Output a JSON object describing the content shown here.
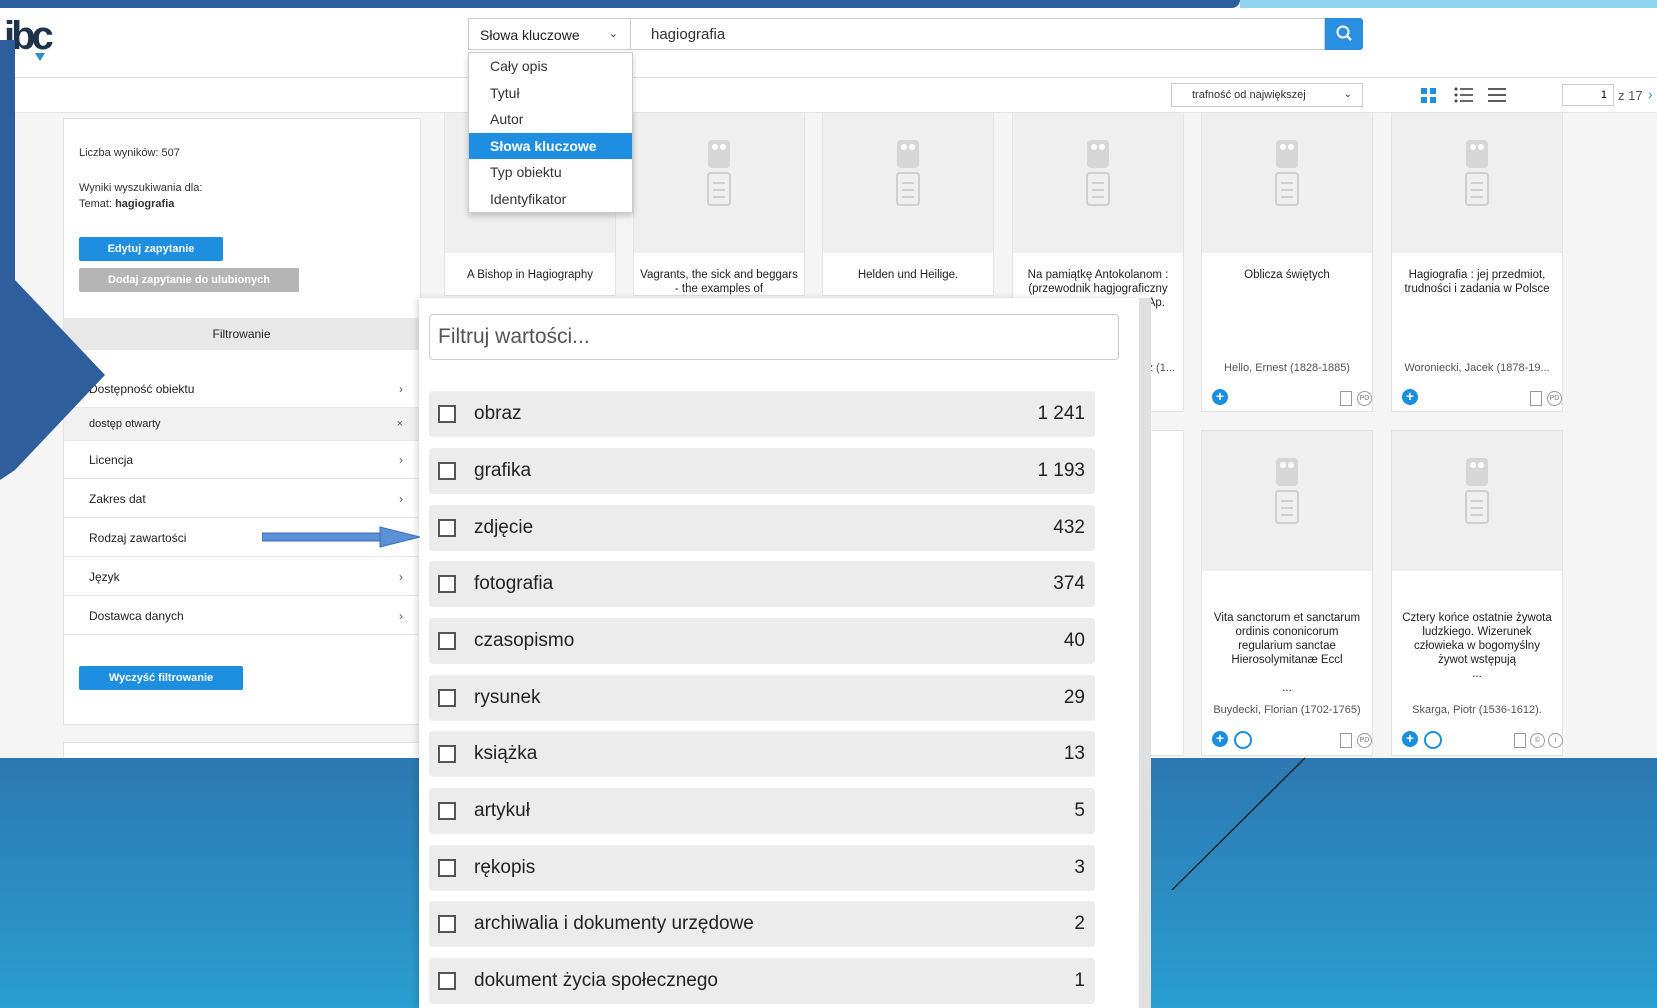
{
  "search": {
    "type_selected": "Słowa kluczowe",
    "query": "hagiografia",
    "type_options": [
      "Cały opis",
      "Tytuł",
      "Autor",
      "Słowa kluczowe",
      "Typ obiektu",
      "Identyfikator"
    ]
  },
  "toolbar": {
    "sort_selected": "trafność od największej",
    "page_current": "1",
    "page_total": "z 17"
  },
  "sidebar": {
    "results_label": "Liczba wyników:",
    "results_count": "507",
    "results_for": "Wyniki wyszukiwania dla:",
    "topic_label": "Temat:",
    "topic_value": "hagiografia",
    "edit_query": "Edytuj zapytanie",
    "add_favorite": "Dodaj zapytanie do ulubionych",
    "filter_header": "Filtrowanie",
    "filters": [
      "Dostępność obiektu",
      "Licencja",
      "Zakres dat",
      "Rodzaj zawartości",
      "Język",
      "Dostawca danych"
    ],
    "active_filter": "dostęp otwarty",
    "clear_filters": "Wyczyść filtrowanie"
  },
  "cards": [
    {
      "title": "A Bishop in Hagiography",
      "author": ""
    },
    {
      "title": "Vagrants, the sick and beggars - the examples of",
      "author": ""
    },
    {
      "title": "Helden und Heilige.",
      "author": ""
    },
    {
      "title": "Na pamiątkę Antokolanom : (przewodnik hagjograficzny",
      "title_tail": "Ap.",
      "author": "z (1..."
    },
    {
      "title": "Oblicza świętych",
      "author": "Hello, Ernest (1828-1885)"
    },
    {
      "title": "Hagiografia : jej przedmiot, trudności i zadania w Polsce",
      "author": "Woroniecki, Jacek (1878-19..."
    },
    {
      "title": "Vita sanctorum et sanctarum ordinis cononicorum regularium sanctae Hierosolymitanæ Eccl",
      "ellipsis": "...",
      "author": "Buydecki, Florian (1702-1765)"
    },
    {
      "title": "Cztery końce ostatnie żywota ludzkiego. Wizerunek człowieka w bogomyślny żywot wstępują",
      "ellipsis": "...",
      "author": "Skarga, Piotr (1536-1612)."
    }
  ],
  "filter_panel": {
    "placeholder": "Filtruj wartości...",
    "options": [
      {
        "label": "obraz",
        "count": "1 241"
      },
      {
        "label": "grafika",
        "count": "1 193"
      },
      {
        "label": "zdjęcie",
        "count": "432"
      },
      {
        "label": "fotografia",
        "count": "374"
      },
      {
        "label": "czasopismo",
        "count": "40"
      },
      {
        "label": "rysunek",
        "count": "29"
      },
      {
        "label": "książka",
        "count": "13"
      },
      {
        "label": "artykuł",
        "count": "5"
      },
      {
        "label": "rękopis",
        "count": "3"
      },
      {
        "label": "archiwalia i dokumenty urzędowe",
        "count": "2"
      },
      {
        "label": "dokument życia społecznego",
        "count": "1"
      }
    ]
  },
  "colors": {
    "accent": "#1e8fe0",
    "slide_blue": "#2e5f9c",
    "arrow": "#5b8fd6"
  }
}
